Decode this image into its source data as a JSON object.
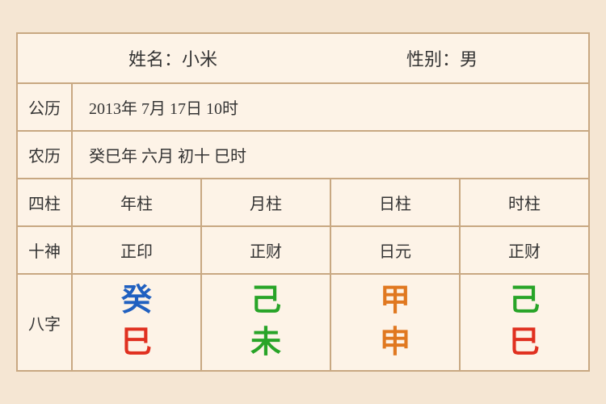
{
  "header": {
    "name_label": "姓名：小米",
    "gender_label": "性别：男"
  },
  "solar": {
    "label": "公历",
    "value": "2013年 7月 17日 10时"
  },
  "lunar": {
    "label": "农历",
    "value": "癸巳年 六月 初十 巳时"
  },
  "pillars": {
    "label": "四柱",
    "columns": [
      "年柱",
      "月柱",
      "日柱",
      "时柱"
    ]
  },
  "shishen": {
    "label": "十神",
    "columns": [
      "正印",
      "正财",
      "日元",
      "正财"
    ]
  },
  "bazi": {
    "label": "八字",
    "columns": [
      {
        "top": "癸",
        "top_color": "blue",
        "bottom": "巳",
        "bottom_color": "red"
      },
      {
        "top": "己",
        "top_color": "green",
        "bottom": "未",
        "bottom_color": "green"
      },
      {
        "top": "甲",
        "top_color": "orange",
        "bottom": "申",
        "bottom_color": "orange"
      },
      {
        "top": "己",
        "top_color": "green",
        "bottom": "巳",
        "bottom_color": "red"
      }
    ]
  }
}
